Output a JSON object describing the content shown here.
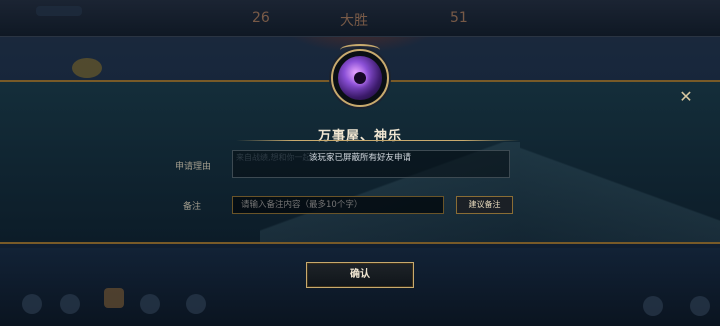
{
  "dialog": {
    "title": "万事屋、神乐",
    "notice": "该玩家已屏蔽所有好友申请",
    "reason_label": "申请理由",
    "reason_placeholder": "来自战绩,想和你一起玩！可以交个朋友吗？",
    "remark_label": "备注",
    "remark_placeholder": "请输入备注内容（最多10个字）",
    "suggest_button": "建议备注",
    "confirm_button": "确认",
    "close_icon": "✕"
  },
  "background": {
    "score_left": "26",
    "score_center": "大胜",
    "score_right": "51"
  },
  "colors": {
    "gold": "#c8aa6e",
    "panel": "#142e3a",
    "text": "#f0e6d2"
  }
}
